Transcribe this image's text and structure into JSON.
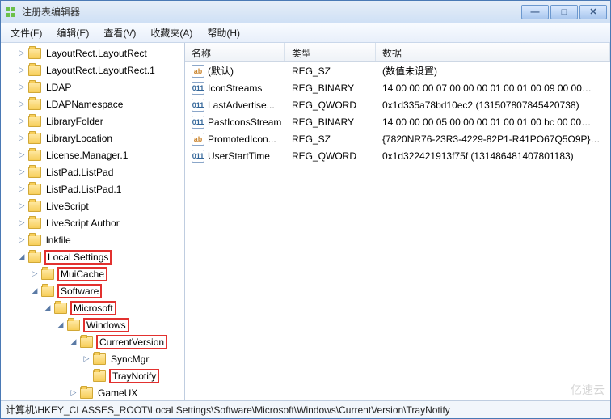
{
  "title": "注册表编辑器",
  "window_buttons": {
    "min": "—",
    "max": "□",
    "close": "✕"
  },
  "menus": [
    "文件(F)",
    "编辑(E)",
    "查看(V)",
    "收藏夹(A)",
    "帮助(H)"
  ],
  "tree": {
    "items": [
      {
        "indent": 1,
        "exp": "▷",
        "label": "LayoutRect.LayoutRect",
        "hl": false
      },
      {
        "indent": 1,
        "exp": "▷",
        "label": "LayoutRect.LayoutRect.1",
        "hl": false
      },
      {
        "indent": 1,
        "exp": "▷",
        "label": "LDAP",
        "hl": false
      },
      {
        "indent": 1,
        "exp": "▷",
        "label": "LDAPNamespace",
        "hl": false
      },
      {
        "indent": 1,
        "exp": "▷",
        "label": "LibraryFolder",
        "hl": false
      },
      {
        "indent": 1,
        "exp": "▷",
        "label": "LibraryLocation",
        "hl": false
      },
      {
        "indent": 1,
        "exp": "▷",
        "label": "License.Manager.1",
        "hl": false
      },
      {
        "indent": 1,
        "exp": "▷",
        "label": "ListPad.ListPad",
        "hl": false
      },
      {
        "indent": 1,
        "exp": "▷",
        "label": "ListPad.ListPad.1",
        "hl": false
      },
      {
        "indent": 1,
        "exp": "▷",
        "label": "LiveScript",
        "hl": false
      },
      {
        "indent": 1,
        "exp": "▷",
        "label": "LiveScript Author",
        "hl": false
      },
      {
        "indent": 1,
        "exp": "▷",
        "label": "lnkfile",
        "hl": false
      },
      {
        "indent": 1,
        "exp": "◢",
        "label": "Local Settings",
        "hl": true
      },
      {
        "indent": 2,
        "exp": "▷",
        "label": "MuiCache",
        "hl": true
      },
      {
        "indent": 2,
        "exp": "◢",
        "label": "Software",
        "hl": true
      },
      {
        "indent": 3,
        "exp": "◢",
        "label": "Microsoft",
        "hl": true
      },
      {
        "indent": 4,
        "exp": "◢",
        "label": "Windows",
        "hl": true
      },
      {
        "indent": 5,
        "exp": "◢",
        "label": "CurrentVersion",
        "hl": true
      },
      {
        "indent": 6,
        "exp": "▷",
        "label": "SyncMgr",
        "hl": false
      },
      {
        "indent": 6,
        "exp": "",
        "label": "TrayNotify",
        "hl": true
      },
      {
        "indent": 5,
        "exp": "▷",
        "label": "GameUX",
        "hl": false
      }
    ]
  },
  "grid": {
    "headers": {
      "name": "名称",
      "type": "类型",
      "data": "数据"
    },
    "rows": [
      {
        "icon": "sz",
        "name": "(默认)",
        "type": "REG_SZ",
        "data": "(数值未设置)"
      },
      {
        "icon": "bin",
        "name": "IconStreams",
        "type": "REG_BINARY",
        "data": "14 00 00 00 07 00 00 00 01 00 01 00 09 00 00…"
      },
      {
        "icon": "bin",
        "name": "LastAdvertise...",
        "type": "REG_QWORD",
        "data": "0x1d335a78bd10ec2 (131507807845420738)"
      },
      {
        "icon": "bin",
        "name": "PastIconsStream",
        "type": "REG_BINARY",
        "data": "14 00 00 00 05 00 00 00 01 00 01 00 bc 00 00…"
      },
      {
        "icon": "sz",
        "name": "PromotedIcon...",
        "type": "REG_SZ",
        "data": "{7820NR76-23R3-4229-82P1-R41PO67Q5O9P}…"
      },
      {
        "icon": "bin",
        "name": "UserStartTime",
        "type": "REG_QWORD",
        "data": "0x1d322421913f75f (131486481407801183)"
      }
    ]
  },
  "status": "计算机\\HKEY_CLASSES_ROOT\\Local Settings\\Software\\Microsoft\\Windows\\CurrentVersion\\TrayNotify",
  "watermark": "亿速云"
}
